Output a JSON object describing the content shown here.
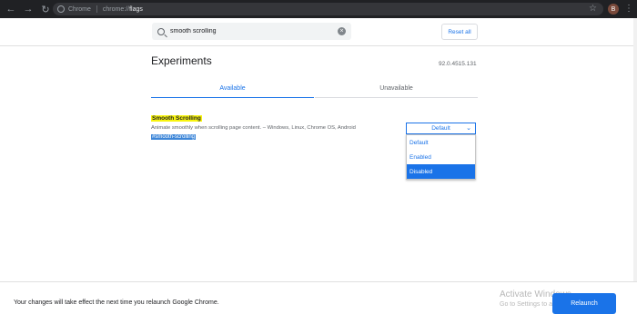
{
  "browser": {
    "nav": {
      "back_icon": "←",
      "forward_icon": "→",
      "reload_icon": "↻"
    },
    "omnibox": {
      "chip_label": "Chrome",
      "url_scheme": "chrome://",
      "url_path": "flags"
    },
    "star_icon": "☆",
    "avatar_letter": "B",
    "menu_icon": "⋮"
  },
  "search": {
    "value": "smooth scrolling",
    "clear_icon": "×"
  },
  "reset_label": "Reset all",
  "page": {
    "title": "Experiments",
    "version": "92.0.4515.131"
  },
  "tabs": [
    {
      "label": "Available",
      "active": true
    },
    {
      "label": "Unavailable",
      "active": false
    }
  ],
  "experiment": {
    "title": "Smooth Scrolling",
    "description": "Animate smoothly when scrolling page content. – Windows, Linux, Chrome OS, Android",
    "tag": "#smooth-scrolling",
    "select": {
      "value": "Default",
      "chevron_icon": "⌄",
      "options": [
        "Default",
        "Enabled",
        "Disabled"
      ],
      "highlighted_option": "Disabled"
    }
  },
  "footer": {
    "message": "Your changes will take effect the next time you relaunch Google Chrome.",
    "watermark_title": "Activate Windows",
    "watermark_sub": "Go to Settings to activate Windows.",
    "relaunch_label": "Relaunch"
  },
  "colors": {
    "accent": "#1a73e8",
    "highlight": "#f8f40f",
    "tag_bg": "#3d86d8",
    "chrome_bar": "#202124"
  }
}
